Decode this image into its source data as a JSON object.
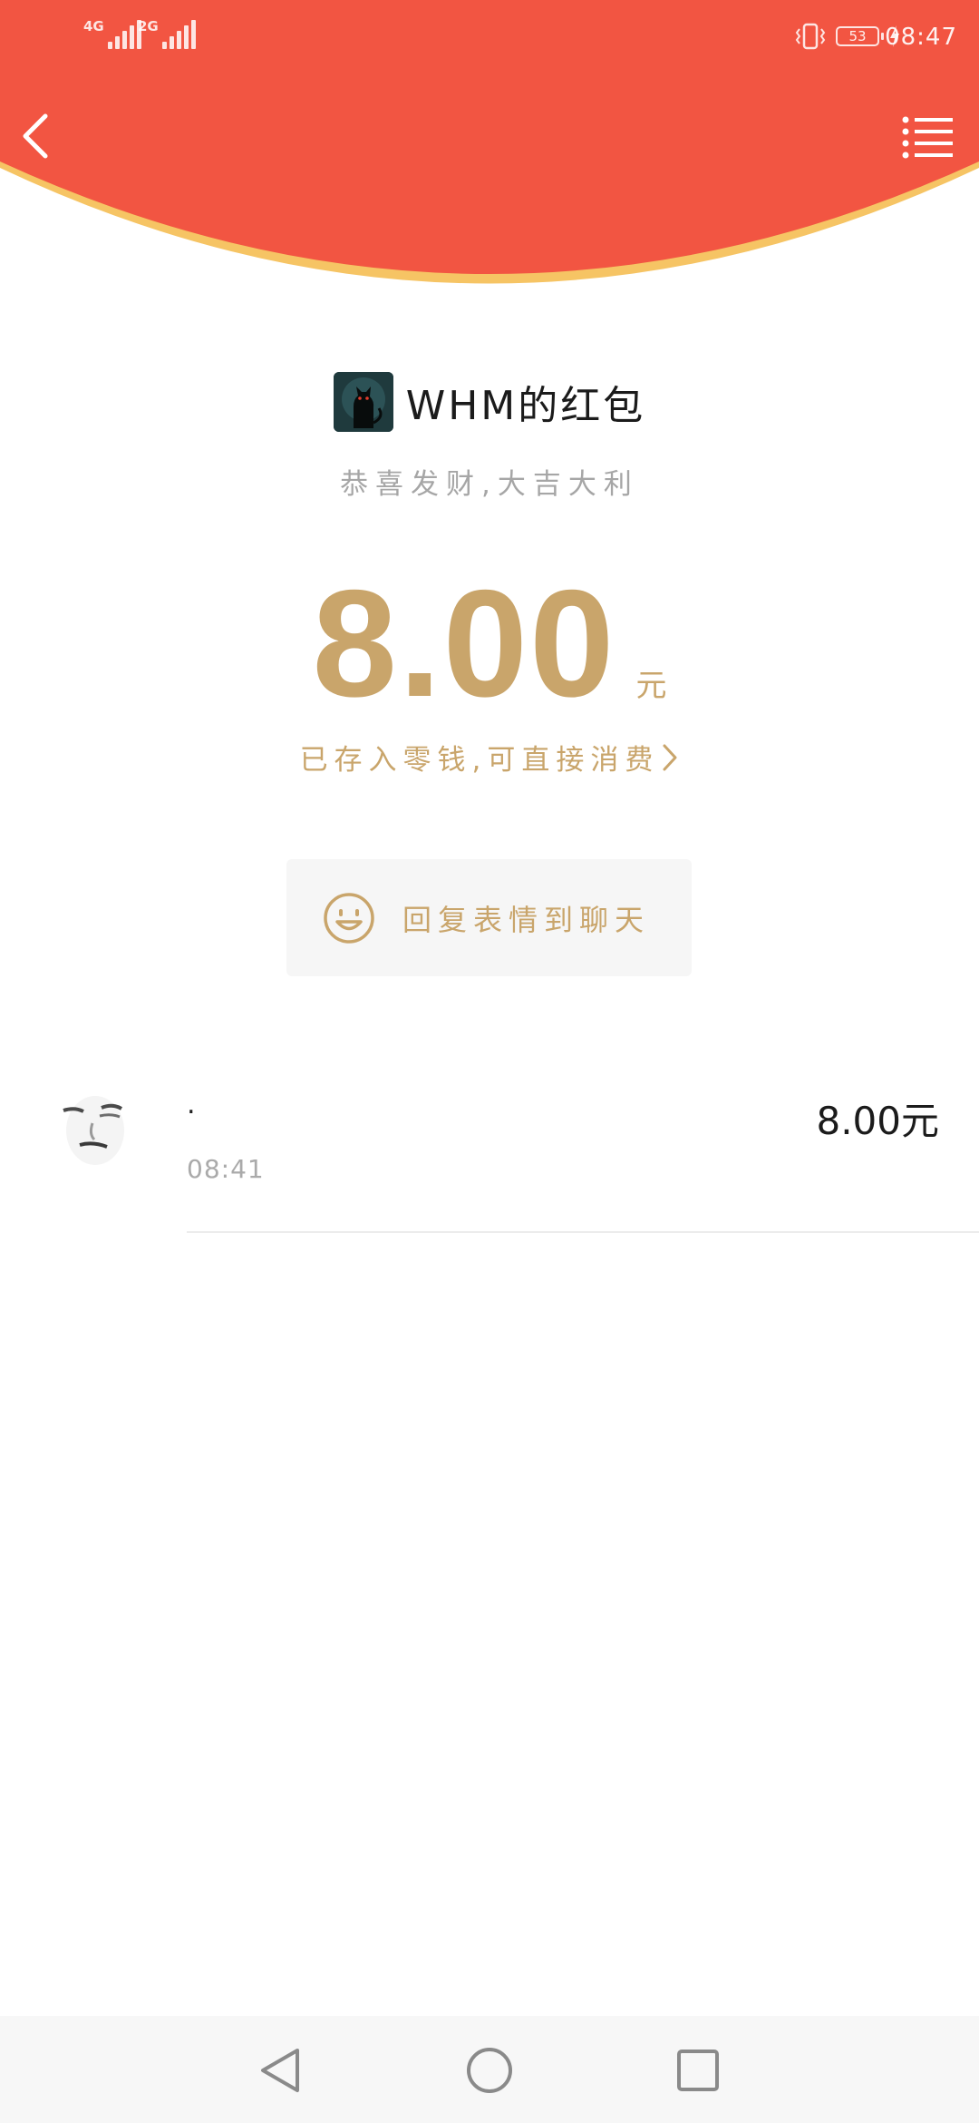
{
  "status_bar": {
    "sim1_network": "4G",
    "sim2_network": "2G",
    "battery_level": "53",
    "time": "08:47"
  },
  "nav": {
    "back_icon": "chevron-left-icon",
    "menu_icon": "list-menu-icon"
  },
  "envelope": {
    "sender_name": "WHM的红包",
    "blessing": "恭喜发财,大吉大利",
    "amount": "8.00",
    "unit": "元",
    "change_link": "已存入零钱,可直接消费",
    "reply_button": "回复表情到聊天"
  },
  "receivers": [
    {
      "name": ".",
      "time": "08:41",
      "amount": "8.00元"
    }
  ],
  "colors": {
    "header_red": "#f25542",
    "header_rim": "#f6c464",
    "gold": "#c9a56b"
  },
  "system_nav": {
    "back": "triangle-back-icon",
    "home": "circle-home-icon",
    "recents": "square-recents-icon"
  }
}
